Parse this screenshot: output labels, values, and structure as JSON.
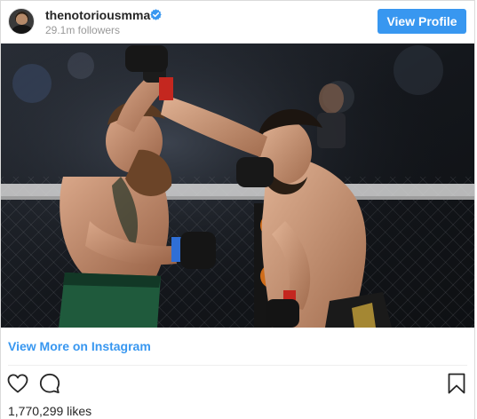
{
  "header": {
    "username": "thenotoriousmma",
    "followers": "29.1m followers",
    "view_profile_label": "View Profile",
    "verified_icon": "verified-badge-icon"
  },
  "post": {
    "image_alt": "fighter-photo",
    "view_more_label": "View More on Instagram",
    "likes": "1,770,299 likes"
  },
  "icons": {
    "like": "heart-icon",
    "comment": "comment-icon",
    "save": "bookmark-icon"
  },
  "colors": {
    "accent": "#3897f0",
    "text": "#262626",
    "muted": "#999999",
    "border": "#dbdbdb"
  }
}
